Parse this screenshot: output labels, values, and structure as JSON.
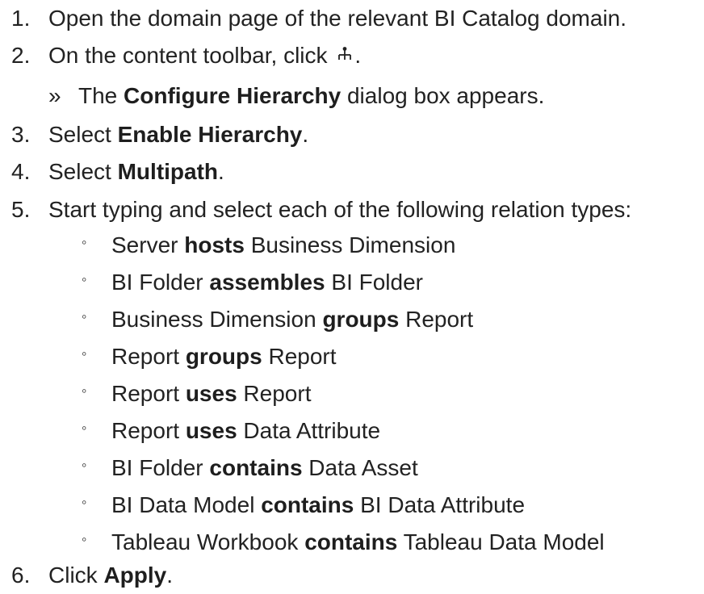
{
  "steps": [
    {
      "num": "1.",
      "text": "Open the domain page of the relevant BI Catalog domain."
    },
    {
      "num": "2.",
      "before": "On the content toolbar, click ",
      "icon": "hierarchy-icon",
      "after": "."
    },
    {
      "marker": "»",
      "before": "The ",
      "bold": "Configure Hierarchy",
      "after": " dialog box appears."
    },
    {
      "num": "3.",
      "before": "Select ",
      "bold": "Enable Hierarchy",
      "after": "."
    },
    {
      "num": "4.",
      "before": "Select ",
      "bold": "Multipath",
      "after": "."
    },
    {
      "num": "5.",
      "text": "Start typing and select each of the following relation types:"
    },
    {
      "num": "6.",
      "before": "Click ",
      "bold": "Apply",
      "after": "."
    }
  ],
  "relation_types": [
    {
      "before": "Server ",
      "bold": "hosts",
      "after": " Business Dimension"
    },
    {
      "before": "BI Folder ",
      "bold": "assembles",
      "after": " BI Folder"
    },
    {
      "before": "Business Dimension ",
      "bold": "groups",
      "after": " Report"
    },
    {
      "before": "Report ",
      "bold": "groups",
      "after": " Report"
    },
    {
      "before": "Report ",
      "bold": "uses",
      "after": " Report"
    },
    {
      "before": "Report ",
      "bold": "uses",
      "after": " Data Attribute"
    },
    {
      "before": "BI Folder ",
      "bold": "contains",
      "after": " Data Asset"
    },
    {
      "before": "BI Data Model ",
      "bold": "contains",
      "after": " BI Data Attribute"
    },
    {
      "before": "Tableau Workbook ",
      "bold": "contains",
      "after": " Tableau Data Model"
    }
  ],
  "sub_marker": "◦"
}
